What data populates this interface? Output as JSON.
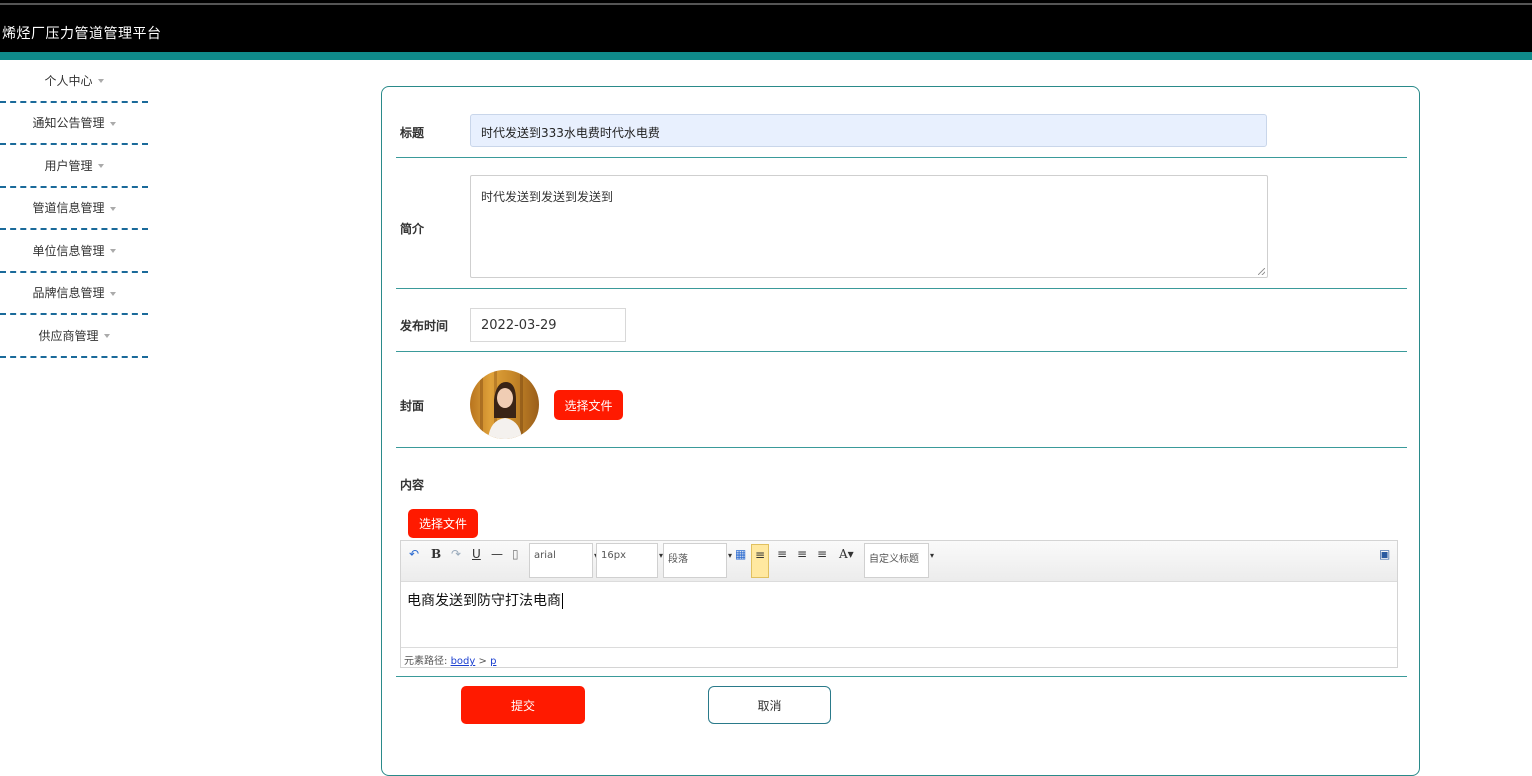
{
  "app": {
    "title": "烯烃厂压力管道管理平台"
  },
  "sidebar": {
    "items": [
      {
        "label": "个人中心"
      },
      {
        "label": "通知公告管理"
      },
      {
        "label": "用户管理"
      },
      {
        "label": "管道信息管理"
      },
      {
        "label": "单位信息管理"
      },
      {
        "label": "品牌信息管理"
      },
      {
        "label": "供应商管理"
      }
    ]
  },
  "form": {
    "title_label": "标题",
    "title_value": "时代发送到333水电费时代水电费",
    "intro_label": "简介",
    "intro_value": "时代发送到发送到发送到",
    "date_label": "发布时间",
    "date_value": "2022-03-29",
    "cover_label": "封面",
    "cover_button": "选择文件",
    "content_label": "内容",
    "content_button": "选择文件",
    "submit_button": "提交",
    "cancel_button": "取消"
  },
  "editor": {
    "font_family": "arial",
    "font_size": "16px",
    "paragraph": "段落",
    "custom_heading": "自定义标题",
    "content_text": "电商发送到防守打法电商",
    "path_label": "元素路径:",
    "path_body": "body",
    "path_sep": ">",
    "path_p": "p"
  },
  "colors": {
    "accent": "#ff1a00",
    "teal": "#0f8a8a",
    "header": "#000000"
  }
}
